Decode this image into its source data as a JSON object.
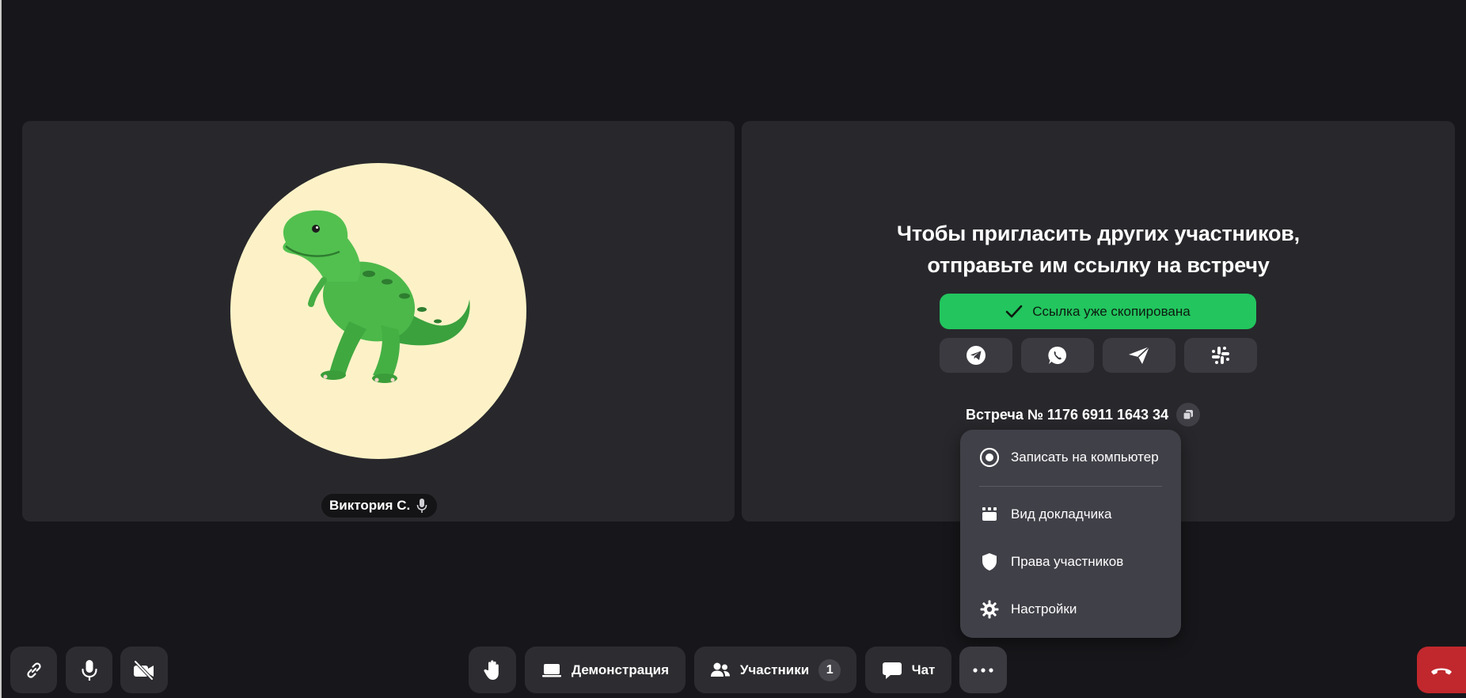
{
  "participant": {
    "name": "Виктория С."
  },
  "invite": {
    "title_line1": "Чтобы пригласить других участников,",
    "title_line2": "отправьте им ссылку на встречу",
    "copied_label": "Ссылка уже скопирована",
    "share_targets": [
      "telegram-icon",
      "whatsapp-icon",
      "send-icon",
      "slack-icon"
    ]
  },
  "meeting": {
    "id_label": "Встреча № 1176 6911 1643 34"
  },
  "more_menu": {
    "items": [
      {
        "label": "Записать на компьютер",
        "icon": "record-icon"
      },
      {
        "label": "Вид докладчика",
        "icon": "speaker-view-icon"
      },
      {
        "label": "Права участников",
        "icon": "shield-icon"
      },
      {
        "label": "Настройки",
        "icon": "gear-icon"
      }
    ]
  },
  "toolbar": {
    "demo_label": "Демонстрация",
    "participants_label": "Участники",
    "participants_count": "1",
    "chat_label": "Чат"
  },
  "colors": {
    "background": "#17171b",
    "tile": "#28282c",
    "accent_green": "#22c55e",
    "hangup_red": "#c0282d",
    "avatar_bg": "#fdf2c7"
  }
}
